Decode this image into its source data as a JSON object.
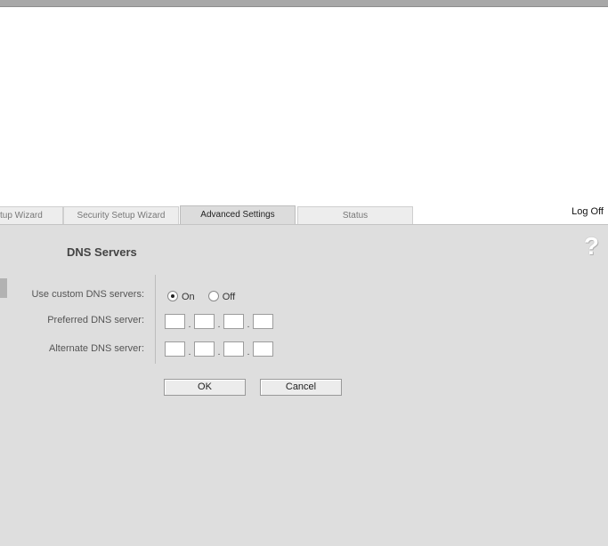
{
  "tabs": [
    {
      "label": "tup Wizard"
    },
    {
      "label": "Security Setup Wizard"
    },
    {
      "label": "Advanced Settings"
    },
    {
      "label": "Status"
    }
  ],
  "header": {
    "logoff": "Log Off"
  },
  "panel": {
    "title": "DNS Servers",
    "help_icon": "?",
    "use_custom_label": "Use custom DNS servers:",
    "on_label": "On",
    "off_label": "Off",
    "custom_dns_value": "On",
    "preferred_label": "Preferred DNS server:",
    "alternate_label": "Alternate DNS server:",
    "ok_label": "OK",
    "cancel_label": "Cancel"
  }
}
